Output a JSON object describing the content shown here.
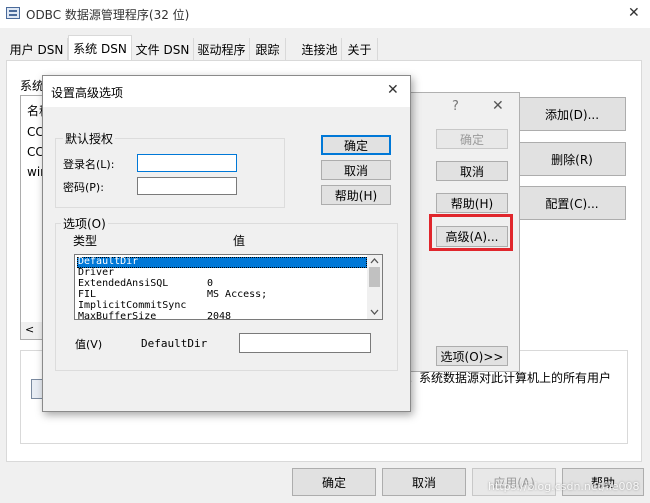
{
  "window": {
    "title": "ODBC 数据源管理程序(32 位)",
    "close_glyph": "✕"
  },
  "tabs": [
    {
      "label": "用户 DSN"
    },
    {
      "label": "系统 DSN"
    },
    {
      "label": "文件 DSN"
    },
    {
      "label": "驱动程序"
    },
    {
      "label": "跟踪"
    },
    {
      "label": "连接池"
    },
    {
      "label": "关于"
    }
  ],
  "main": {
    "list_label": "系统",
    "list_header": "名称",
    "list_rows": [
      "CC",
      "CC",
      "wir"
    ],
    "side_buttons": {
      "add": "添加(D)...",
      "remove": "删除(R)",
      "configure": "配置(C)..."
    },
    "info_text": "。系统数据源对此计算机上的所有用户",
    "scroll_left": "<"
  },
  "mid_dialog": {
    "help_glyph": "?",
    "close_glyph": "✕",
    "ok": "确定",
    "cancel": "取消",
    "help": "帮助(H)",
    "advanced": "高级(A)...",
    "options": "选项(O)>>"
  },
  "adv_dialog": {
    "title": "设置高级选项",
    "close_glyph": "✕",
    "auth_group": "默认授权",
    "login_label": "登录名(L):",
    "password_label": "密码(P):",
    "login_value": "",
    "password_value": "",
    "ok": "确定",
    "cancel": "取消",
    "help": "帮助(H)",
    "options_group": "选项(O)",
    "col_type": "类型",
    "col_value": "值",
    "rows": [
      {
        "type": "DefaultDir",
        "value": ""
      },
      {
        "type": "Driver",
        "value": ""
      },
      {
        "type": "ExtendedAnsiSQL",
        "value": "0"
      },
      {
        "type": "FIL",
        "value": "MS Access;"
      },
      {
        "type": "ImplicitCommitSync",
        "value": ""
      },
      {
        "type": "MaxBufferSize",
        "value": "2048"
      }
    ],
    "value_label": "值(V)",
    "value_key": "DefaultDir",
    "value_field": ""
  },
  "bottom_buttons": {
    "ok": "确定",
    "cancel": "取消",
    "apply": "应用(A)",
    "help": "帮助"
  },
  "watermark": "https://blog.csdn.net/lie008",
  "colors": {
    "highlight_box": "#e0262c",
    "selection": "#0078d7",
    "accent_border": "#0078d7"
  }
}
